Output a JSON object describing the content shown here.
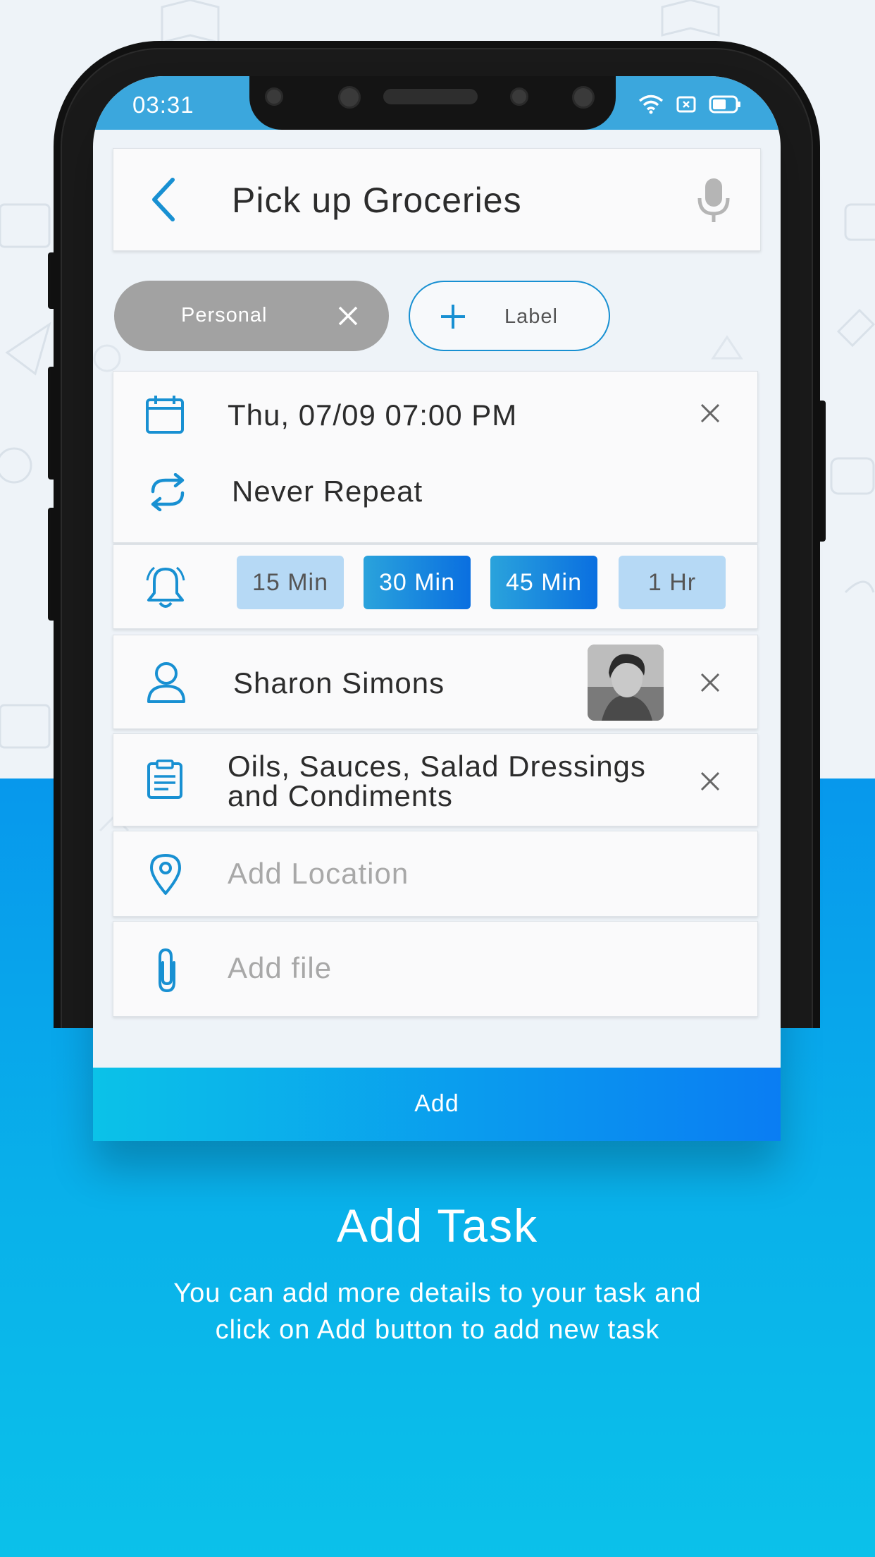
{
  "status_bar": {
    "time": "03:31"
  },
  "task": {
    "title": "Pick up Groceries"
  },
  "labels": {
    "chips": [
      {
        "label": "Personal"
      }
    ],
    "add_label": "Label"
  },
  "schedule": {
    "datetime": "Thu, 07/09 07:00 PM",
    "repeat": "Never Repeat"
  },
  "reminder": {
    "options": [
      {
        "label": "15 Min",
        "selected": false
      },
      {
        "label": "30 Min",
        "selected": true
      },
      {
        "label": "45 Min",
        "selected": true
      },
      {
        "label": "1 Hr",
        "selected": false
      }
    ]
  },
  "assignee": {
    "name": "Sharon Simons"
  },
  "note": {
    "line1": "Oils, Sauces, Salad Dressings",
    "line2": "and Condiments"
  },
  "location": {
    "placeholder": "Add Location"
  },
  "file": {
    "placeholder": "Add file"
  },
  "add_button": {
    "label": "Add"
  },
  "promo": {
    "headline": "Add Task",
    "line1": "You can add more details to your task and",
    "line2": "click on Add button to add new task"
  },
  "colors": {
    "accent": "#1890d2",
    "status_bar": "#3ba7dd",
    "panel": "#0aa8eb",
    "chip_grey": "#a2a2a2"
  },
  "icons": [
    "back-arrow-icon",
    "microphone-icon",
    "close-icon",
    "plus-icon",
    "calendar-icon",
    "repeat-icon",
    "bell-icon",
    "person-icon",
    "notes-icon",
    "location-pin-icon",
    "paperclip-icon",
    "wifi-icon",
    "sim-icon",
    "battery-icon"
  ]
}
